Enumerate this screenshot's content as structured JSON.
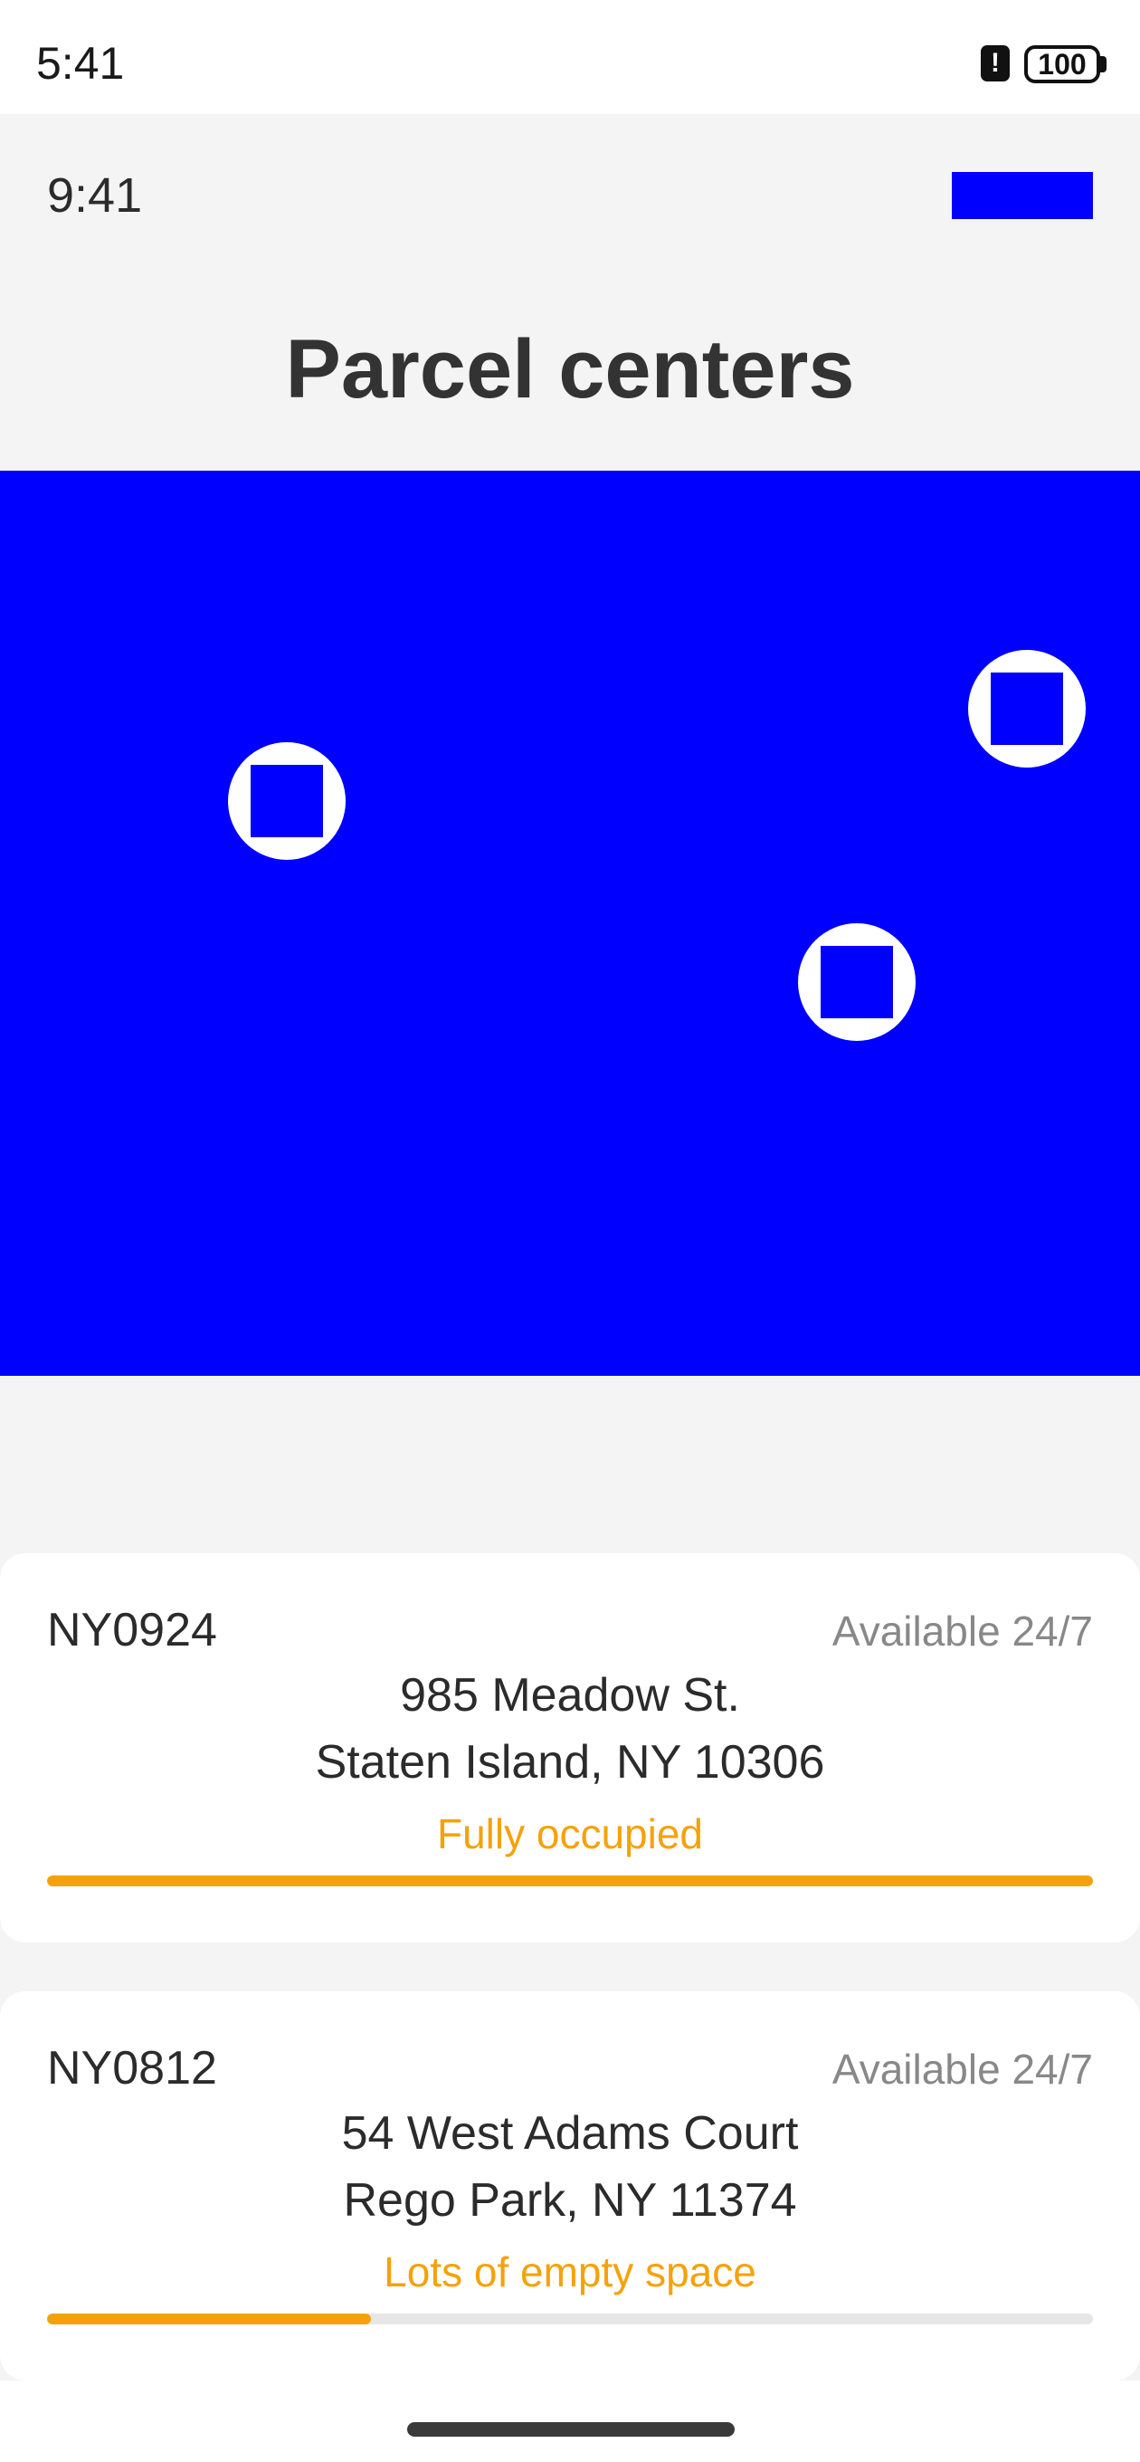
{
  "status_bar": {
    "time": "5:41",
    "alert_glyph": "!",
    "battery": "100"
  },
  "header": {
    "time": "9:41",
    "title": "Parcel centers"
  },
  "map": {
    "pins": [
      {
        "icon": "parcel-pin-icon"
      },
      {
        "icon": "parcel-pin-icon"
      },
      {
        "icon": "parcel-pin-icon"
      }
    ]
  },
  "centers": [
    {
      "id": "NY0924",
      "availability": "Available 24/7",
      "address_line1": "985 Meadow St.",
      "address_line2": "Staten Island, NY 10306",
      "status": "Fully occupied",
      "occupancy": 1.0
    },
    {
      "id": "NY0812",
      "availability": "Available 24/7",
      "address_line1": "54 West Adams Court",
      "address_line2": "Rego Park, NY 11374",
      "status": "Lots of empty space",
      "occupancy": 0.31
    }
  ],
  "colors": {
    "accent": "#0000ff",
    "status": "#f5a20a",
    "track": "#e6e6e6"
  }
}
